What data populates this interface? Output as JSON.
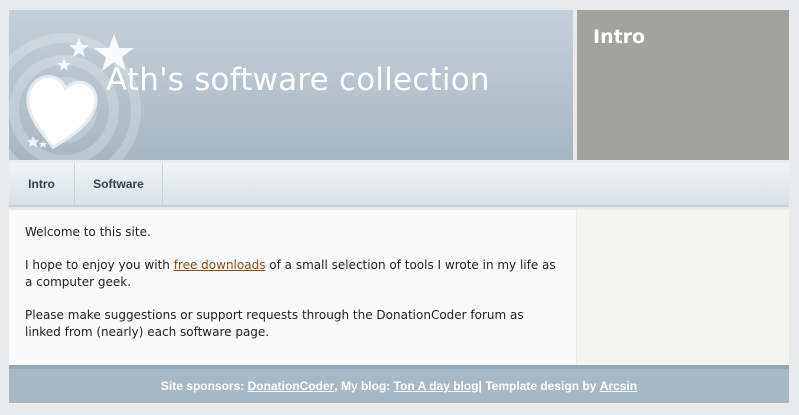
{
  "header": {
    "title": "Ath's software collection",
    "decoration": [
      "heart-icon",
      "star-icon",
      "circles-pattern"
    ]
  },
  "intro_box": {
    "title": "Intro"
  },
  "nav": {
    "items": [
      {
        "label": "Intro"
      },
      {
        "label": "Software"
      }
    ]
  },
  "content": {
    "p1": "Welcome to this site.",
    "p2_before": "I hope to enjoy you with ",
    "p2_link": "free downloads",
    "p2_after": " of a small selection of tools I wrote in my life as a computer geek.",
    "p3": "Please make suggestions or support requests through the DonationCoder forum as linked from (nearly) each software page."
  },
  "footer": {
    "prefix": "Site sponsors: ",
    "sponsor_link": "DonationCoder",
    "blog_prefix": ", My blog: ",
    "blog_link": "Ton A day blog",
    "design_prefix": " | Template design by ",
    "design_link": "Arcsin"
  },
  "colors": {
    "header_bg": "#b4c1cb",
    "intro_bg": "#a3a39e",
    "footer_bg": "#a8b8c4",
    "link": "#8a4a16"
  }
}
